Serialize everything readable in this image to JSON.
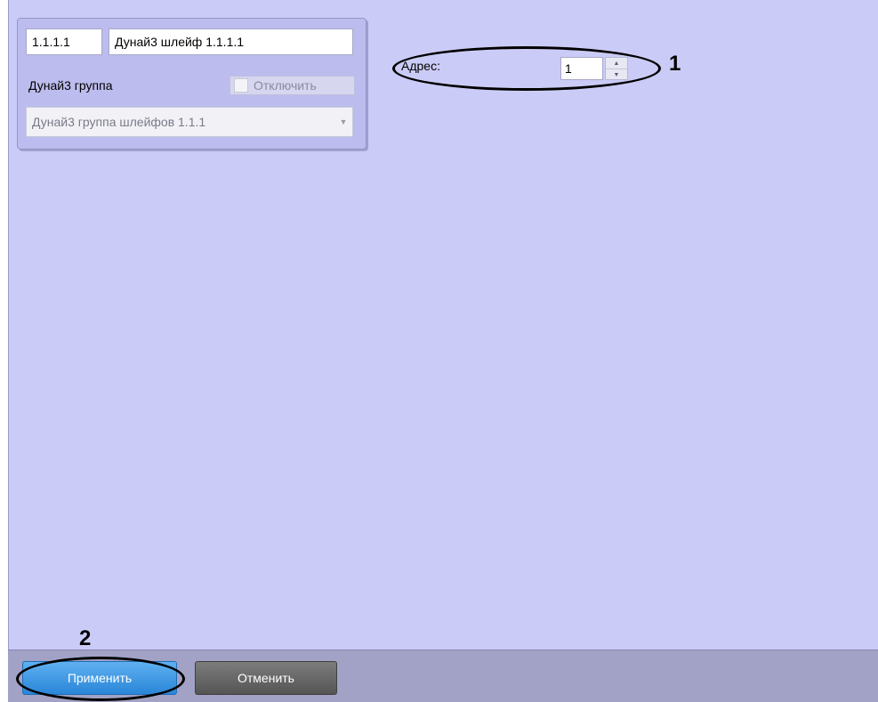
{
  "object_card": {
    "id_value": "1.1.1.1",
    "name_value": "Дунай3 шлейф 1.1.1.1",
    "group_label": "Дунай3 группа",
    "disable_label": "Отключить",
    "disable_checked": false,
    "group_select_value": "Дунай3 группа шлейфов 1.1.1"
  },
  "settings": {
    "address_label": "Адрес:",
    "address_value": "1"
  },
  "callouts": {
    "one": "1",
    "two": "2"
  },
  "actions": {
    "apply_label": "Применить",
    "cancel_label": "Отменить"
  },
  "icons": {
    "dropdown": "chevron-down-icon",
    "spin_up": "spin-up-icon",
    "spin_down": "spin-down-icon"
  },
  "colors": {
    "panel_bg": "#cbcbf7",
    "apply_button": "#2a86d8",
    "cancel_button": "#555555",
    "bottom_bar": "#a2a2c6"
  }
}
